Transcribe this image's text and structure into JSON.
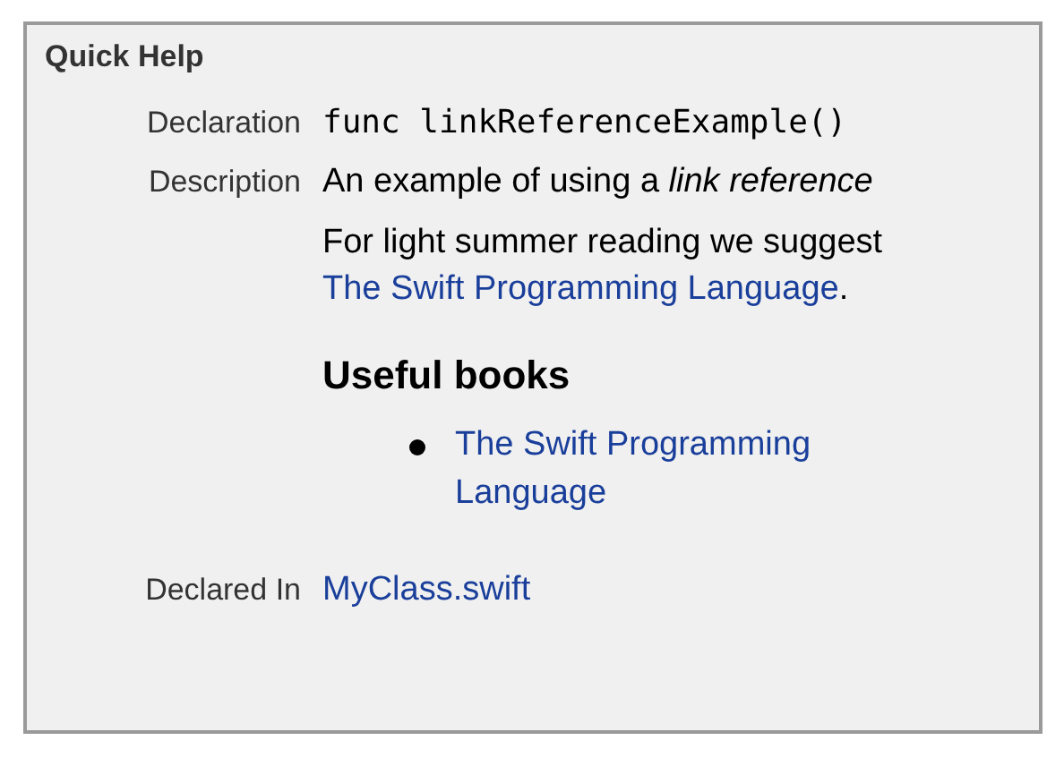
{
  "panel": {
    "title": "Quick Help"
  },
  "declaration": {
    "label": "Declaration",
    "code": "func linkReferenceExample()"
  },
  "description": {
    "label": "Description",
    "summary": "An example of using a *link reference*",
    "paragraph": {
      "before": "For light summer reading we suggest",
      "link": "The Swift Programming Language",
      "after": "."
    },
    "heading": "Useful books",
    "list": [
      {
        "link": "The Swift Programming Language"
      }
    ]
  },
  "declared_in": {
    "label": "Declared In",
    "link": "MyClass.swift"
  }
}
